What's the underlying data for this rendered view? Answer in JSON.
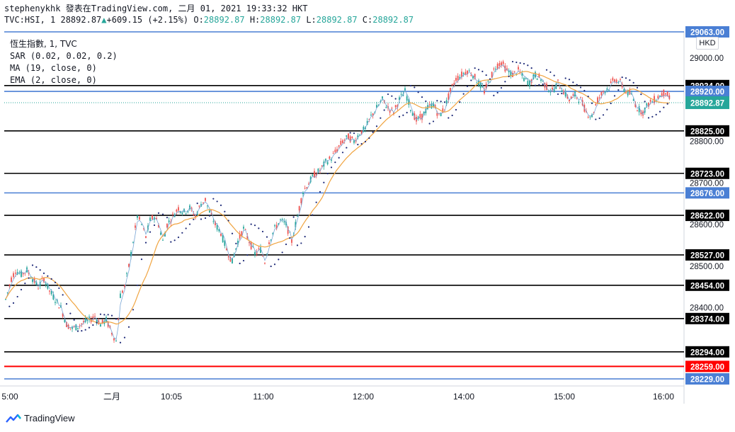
{
  "header": {
    "line1": "stephenykhk 發表在TradingView.com, 二月 01, 2021 19:33:32 HKT",
    "symbol": "TVC:HSI, 1",
    "last": "28892.87",
    "arrow": "▲",
    "change": "+609.15 (+2.15%)",
    "o_label": "O:",
    "o": "28892.87",
    "h_label": "H:",
    "h": "28892.87",
    "l_label": "L:",
    "l": "28892.87",
    "c_label": "C:",
    "c": "28892.87"
  },
  "legend": {
    "title": "恆生指數, 1, TVC",
    "sar": "SAR (0.02, 0.02, 0.2)",
    "ma": "MA (19, close, 0)",
    "ema": "EMA (2, close, 0)"
  },
  "currency": "HKD",
  "brand": "TradingView",
  "colors": {
    "up": "#26a69a",
    "down": "#ef5350",
    "black_line": "#000000",
    "blue_line": "#4a7fd4",
    "red_line": "#ff0000",
    "sar": "#1e2a78",
    "ma": "#f0a440",
    "ema": "#7aa6d6",
    "price_tag": "#26a69a"
  },
  "chart_data": {
    "type": "line",
    "y_ticks": [
      "29000.00",
      "28800.00",
      "28700.00",
      "28600.00",
      "28500.00",
      "28400.00"
    ],
    "x_ticks": [
      "5:00",
      "二月",
      "10:05",
      "11:00",
      "12:00",
      "14:00",
      "15:00",
      "16:00"
    ],
    "ylim": [
      28210,
      29085
    ],
    "horizontal_levels": [
      {
        "value": 29063.0,
        "label": "29063.00",
        "style": "blue"
      },
      {
        "value": 28934.0,
        "label": "28934.00",
        "style": "black"
      },
      {
        "value": 28920.0,
        "label": "28920.00",
        "style": "blue"
      },
      {
        "value": 28825.0,
        "label": "28825.00",
        "style": "black"
      },
      {
        "value": 28723.0,
        "label": "28723.00",
        "style": "black"
      },
      {
        "value": 28676.0,
        "label": "28676.00",
        "style": "blue"
      },
      {
        "value": 28622.0,
        "label": "28622.00",
        "style": "black"
      },
      {
        "value": 28527.0,
        "label": "28527.00",
        "style": "black"
      },
      {
        "value": 28454.0,
        "label": "28454.00",
        "style": "black"
      },
      {
        "value": 28374.0,
        "label": "28374.00",
        "style": "black"
      },
      {
        "value": 28294.0,
        "label": "28294.00",
        "style": "black"
      },
      {
        "value": 28259.0,
        "label": "28259.00",
        "style": "red"
      },
      {
        "value": 28229.0,
        "label": "28229.00",
        "style": "blue"
      }
    ],
    "current_price": {
      "value": 28892.87,
      "label": "28892.87"
    },
    "price_path": [
      [
        0,
        28420
      ],
      [
        8,
        28470
      ],
      [
        14,
        28490
      ],
      [
        22,
        28480
      ],
      [
        30,
        28490
      ],
      [
        38,
        28470
      ],
      [
        46,
        28450
      ],
      [
        54,
        28470
      ],
      [
        62,
        28440
      ],
      [
        70,
        28420
      ],
      [
        78,
        28400
      ],
      [
        86,
        28360
      ],
      [
        94,
        28350
      ],
      [
        102,
        28355
      ],
      [
        110,
        28365
      ],
      [
        118,
        28370
      ],
      [
        126,
        28380
      ],
      [
        134,
        28360
      ],
      [
        142,
        28370
      ],
      [
        150,
        28340
      ],
      [
        156,
        28320
      ],
      [
        162,
        28430
      ],
      [
        168,
        28450
      ],
      [
        174,
        28500
      ],
      [
        180,
        28560
      ],
      [
        186,
        28620
      ],
      [
        192,
        28600
      ],
      [
        198,
        28570
      ],
      [
        204,
        28610
      ],
      [
        210,
        28620
      ],
      [
        216,
        28600
      ],
      [
        222,
        28560
      ],
      [
        228,
        28600
      ],
      [
        236,
        28620
      ],
      [
        244,
        28640
      ],
      [
        252,
        28630
      ],
      [
        260,
        28640
      ],
      [
        268,
        28620
      ],
      [
        276,
        28650
      ],
      [
        282,
        28660
      ],
      [
        288,
        28630
      ],
      [
        296,
        28600
      ],
      [
        304,
        28580
      ],
      [
        312,
        28540
      ],
      [
        320,
        28510
      ],
      [
        328,
        28560
      ],
      [
        336,
        28590
      ],
      [
        344,
        28560
      ],
      [
        352,
        28530
      ],
      [
        360,
        28540
      ],
      [
        366,
        28510
      ],
      [
        372,
        28560
      ],
      [
        380,
        28590
      ],
      [
        388,
        28610
      ],
      [
        396,
        28600
      ],
      [
        404,
        28560
      ],
      [
        412,
        28620
      ],
      [
        420,
        28680
      ],
      [
        428,
        28700
      ],
      [
        436,
        28720
      ],
      [
        444,
        28730
      ],
      [
        452,
        28750
      ],
      [
        460,
        28760
      ],
      [
        468,
        28780
      ],
      [
        476,
        28800
      ],
      [
        484,
        28810
      ],
      [
        492,
        28800
      ],
      [
        500,
        28820
      ],
      [
        508,
        28830
      ],
      [
        516,
        28860
      ],
      [
        524,
        28880
      ],
      [
        532,
        28900
      ],
      [
        540,
        28880
      ],
      [
        548,
        28870
      ],
      [
        556,
        28900
      ],
      [
        564,
        28920
      ],
      [
        572,
        28880
      ],
      [
        580,
        28850
      ],
      [
        588,
        28860
      ],
      [
        596,
        28880
      ],
      [
        604,
        28890
      ],
      [
        612,
        28860
      ],
      [
        620,
        28880
      ],
      [
        628,
        28920
      ],
      [
        636,
        28950
      ],
      [
        644,
        28960
      ],
      [
        652,
        28970
      ],
      [
        660,
        28960
      ],
      [
        668,
        28940
      ],
      [
        676,
        28920
      ],
      [
        684,
        28950
      ],
      [
        692,
        28980
      ],
      [
        700,
        28990
      ],
      [
        708,
        28970
      ],
      [
        716,
        28960
      ],
      [
        724,
        28970
      ],
      [
        732,
        28950
      ],
      [
        740,
        28940
      ],
      [
        748,
        28960
      ],
      [
        756,
        28950
      ],
      [
        764,
        28930
      ],
      [
        772,
        28920
      ],
      [
        780,
        28940
      ],
      [
        788,
        28920
      ],
      [
        796,
        28900
      ],
      [
        804,
        28910
      ],
      [
        812,
        28900
      ],
      [
        820,
        28870
      ],
      [
        828,
        28860
      ],
      [
        836,
        28900
      ],
      [
        844,
        28920
      ],
      [
        852,
        28930
      ],
      [
        860,
        28950
      ],
      [
        868,
        28940
      ],
      [
        876,
        28920
      ],
      [
        884,
        28910
      ],
      [
        892,
        28880
      ],
      [
        900,
        28870
      ],
      [
        908,
        28890
      ],
      [
        916,
        28900
      ],
      [
        924,
        28910
      ],
      [
        932,
        28920
      ],
      [
        940,
        28893
      ]
    ]
  }
}
